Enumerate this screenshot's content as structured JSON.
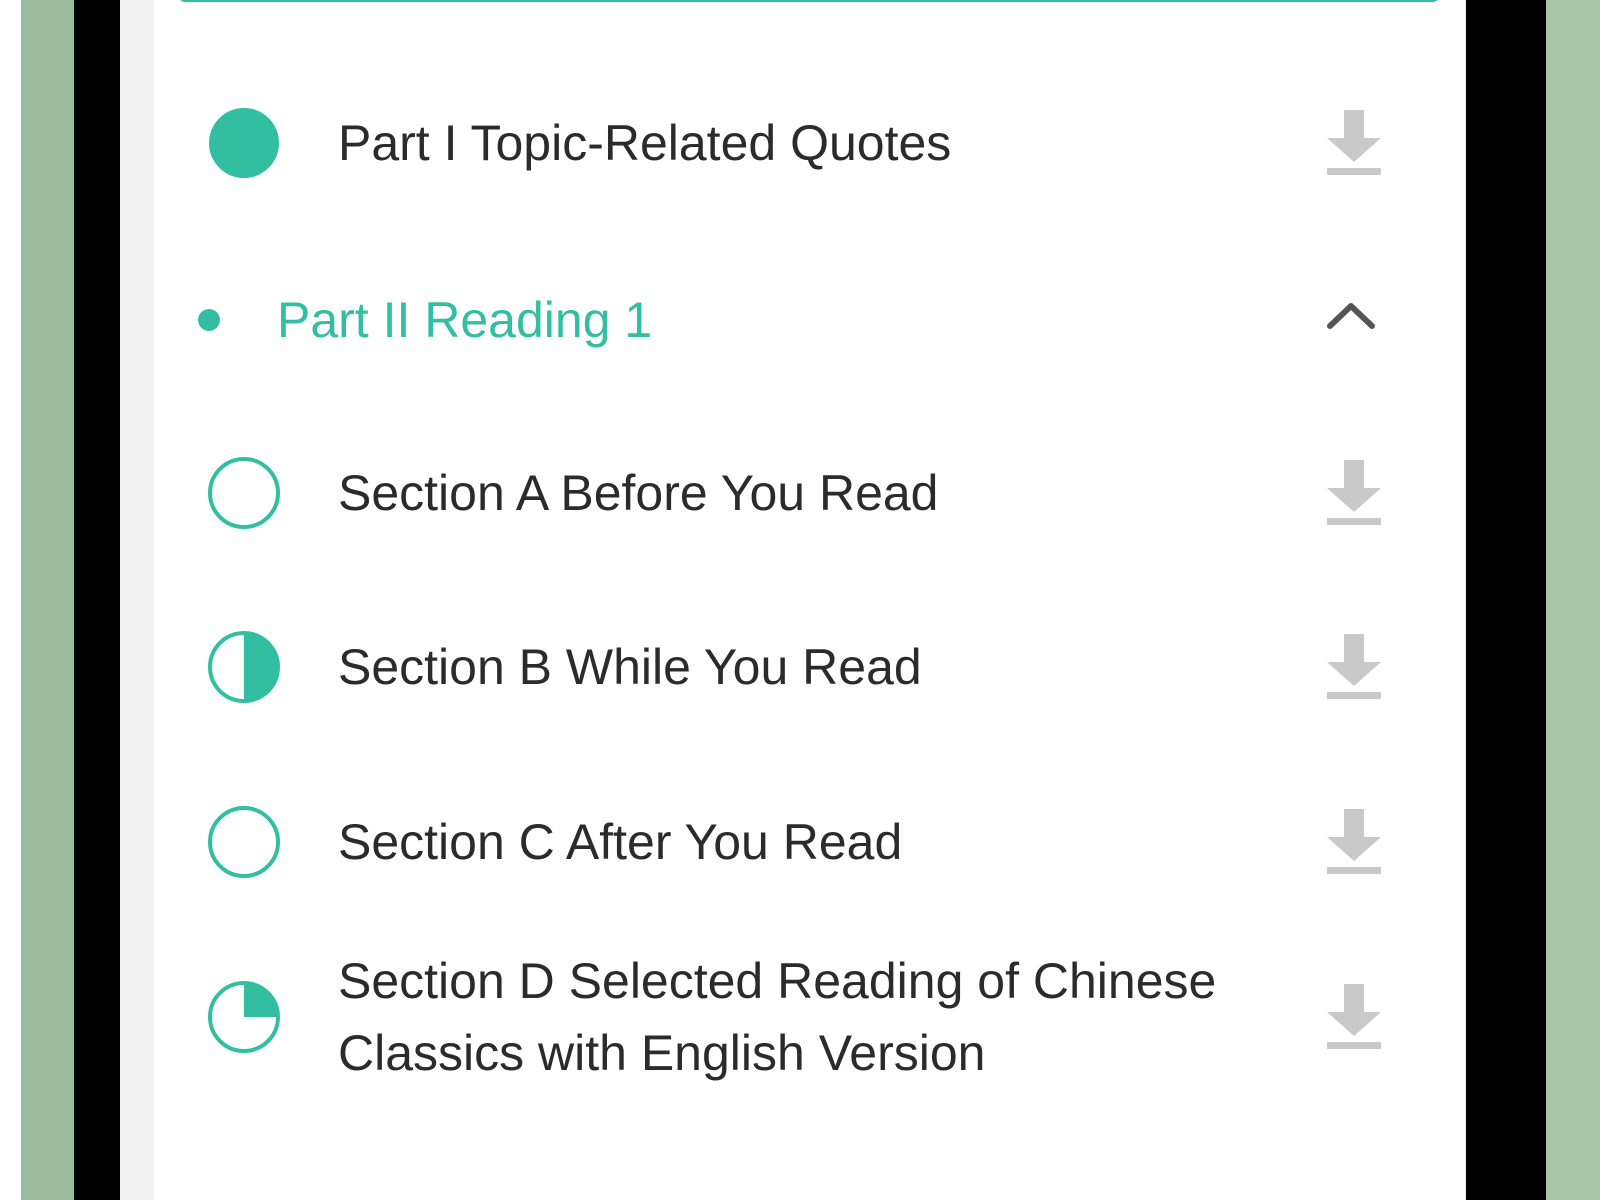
{
  "colors": {
    "accent": "#32bfa1",
    "text": "#2b2b2b",
    "icon_gray": "#c9c9c9",
    "chevron": "#555555"
  },
  "list": {
    "items": [
      {
        "title": "Part I Topic-Related Quotes",
        "progress": 1.0,
        "icon": "download-icon"
      },
      {
        "title": "Part II Reading 1",
        "expanded": true,
        "icon": "chevron-up-icon"
      },
      {
        "title": "Section A Before You Read",
        "progress": 0.0,
        "icon": "download-icon"
      },
      {
        "title": "Section B While You Read",
        "progress": 0.5,
        "icon": "download-icon"
      },
      {
        "title": "Section C After You Read",
        "progress": 0.0,
        "icon": "download-icon"
      },
      {
        "title": "Section D Selected Reading of Chinese Classics with English Version",
        "progress": 0.25,
        "icon": "download-icon"
      }
    ]
  }
}
